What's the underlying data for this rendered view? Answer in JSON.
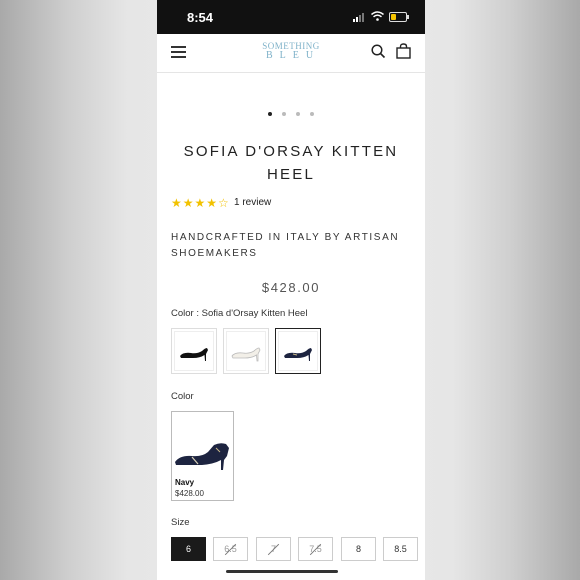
{
  "status_bar": {
    "time": "8:54"
  },
  "header": {
    "logo_line1": "SOMETHING",
    "logo_line2": "BLEU"
  },
  "gallery": {
    "slides": 4,
    "active": 0
  },
  "product": {
    "title_line1": "SOFIA D'ORSAY KITTEN",
    "title_line2": "HEEL",
    "rating": 4.5,
    "stars": "★★★★☆",
    "review_text": "1 review",
    "subtitle": "HANDCRAFTED IN ITALY BY ARTISAN SHOEMAKERS",
    "price": "$428.00"
  },
  "color_selector": {
    "label": "Color : Sofia d'Orsay Kitten Heel",
    "options": [
      "black-shoe",
      "white-shoe",
      "navy-shoe"
    ],
    "selected_index": 2
  },
  "color_section": {
    "label": "Color",
    "card": {
      "name": "Navy",
      "price": "$428.00"
    }
  },
  "size_section": {
    "label": "Size",
    "sizes": [
      {
        "label": "6",
        "selected": true,
        "available": true
      },
      {
        "label": "6.5",
        "selected": false,
        "available": false
      },
      {
        "label": "7",
        "selected": false,
        "available": false
      },
      {
        "label": "7.5",
        "selected": false,
        "available": false
      },
      {
        "label": "8",
        "selected": false,
        "available": true
      },
      {
        "label": "8.5",
        "selected": false,
        "available": true
      }
    ]
  },
  "colors": {
    "brand": "#7fb2c9",
    "star": "#f2c200",
    "text": "#222222"
  }
}
